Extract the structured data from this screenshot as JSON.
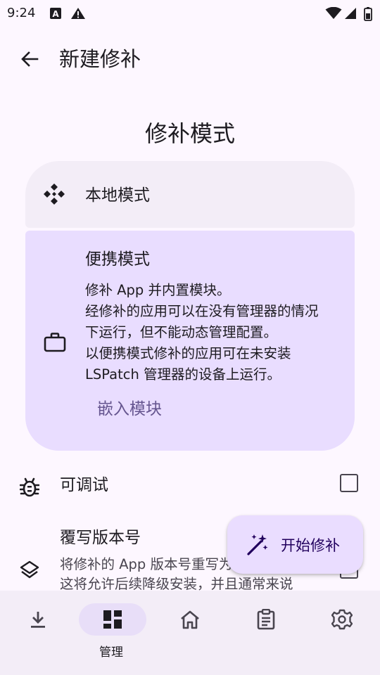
{
  "status_bar": {
    "time": "9:24"
  },
  "app_bar": {
    "title": "新建修补"
  },
  "section_title": "修补模式",
  "modes": {
    "local": {
      "label": "本地模式"
    },
    "portable": {
      "label": "便携模式",
      "description_lines": [
        "修补 App 并内置模块。",
        "经修补的应用可以在没有管理器的情况",
        "下运行，但不能动态管理配置。",
        "以便携模式修补的应用可在未安装",
        "LSPatch 管理器的设备上运行。"
      ],
      "embed_button": "嵌入模块"
    }
  },
  "options": {
    "debuggable": {
      "label": "可调试",
      "checked": false
    },
    "override_version": {
      "label": "覆写版本号",
      "description_lines": [
        "将修补的 App 版本号重写为",
        "这将允许后续降级安装，并且通常来说"
      ],
      "checked": false
    }
  },
  "fab": {
    "label": "开始修补"
  },
  "bottom_nav": {
    "items": [
      {
        "id": "download",
        "icon": "download-icon",
        "label": ""
      },
      {
        "id": "manage",
        "icon": "dashboard-icon",
        "label": "管理",
        "selected": true
      },
      {
        "id": "home",
        "icon": "home-icon",
        "label": ""
      },
      {
        "id": "logs",
        "icon": "clipboard-icon",
        "label": ""
      },
      {
        "id": "settings",
        "icon": "gear-icon",
        "label": ""
      }
    ]
  },
  "colors": {
    "background": "#fdf7ff",
    "card_local": "#f3edf7",
    "card_portable": "#e9ddff",
    "accent_text": "#65558f",
    "fab": "#eaddff",
    "nav_bar": "#f3edf7",
    "nav_indicator": "#e8def8"
  }
}
